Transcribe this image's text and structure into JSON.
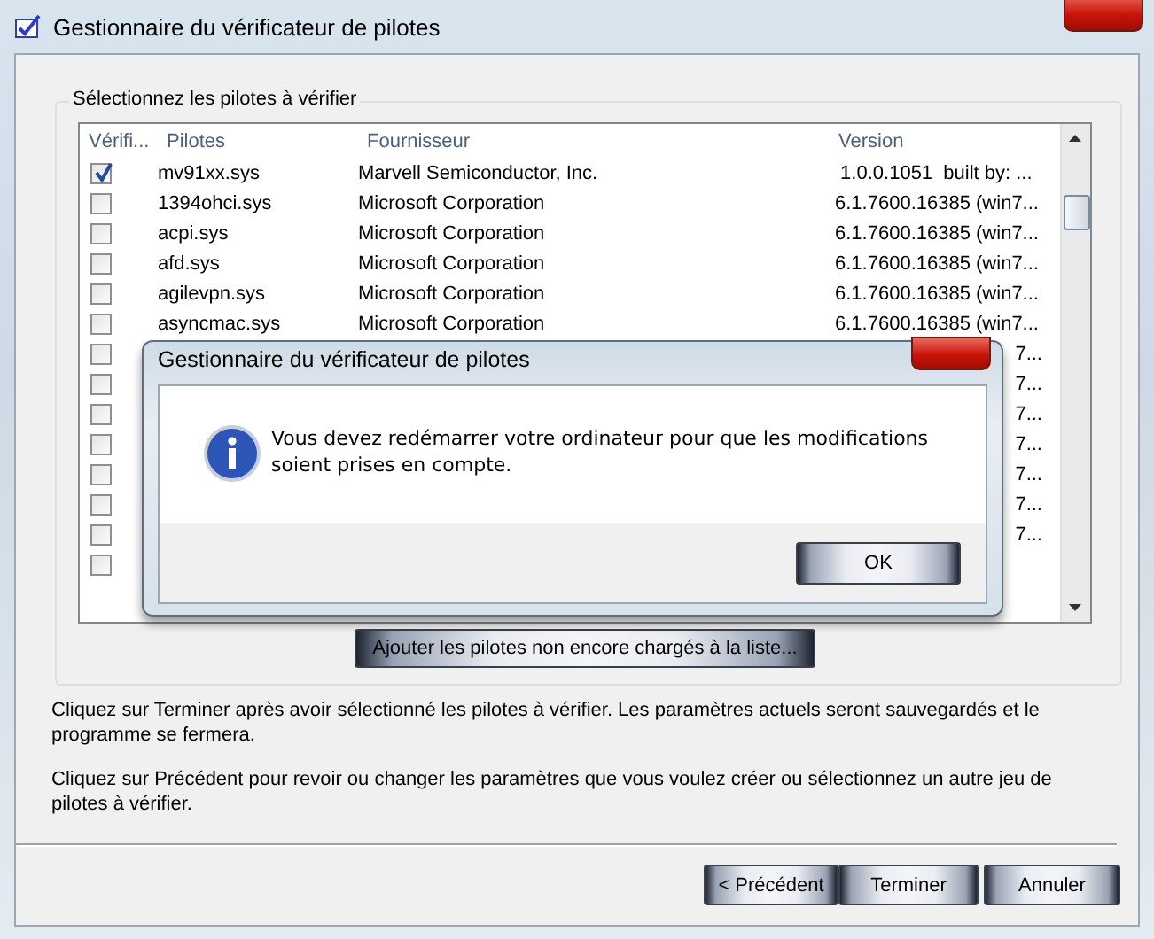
{
  "window": {
    "title": "Gestionnaire du vérificateur de pilotes"
  },
  "group": {
    "label": "Sélectionnez les pilotes à vérifier"
  },
  "table": {
    "columns": [
      "Vérifi...",
      "Pilotes",
      "Fournisseur",
      "Version"
    ],
    "rows": [
      {
        "kind": "full",
        "checked": true,
        "name": "mv91xx.sys",
        "vendor": "Marvell Semiconductor, Inc.",
        "version": " 1.0.0.1051  built by: ..."
      },
      {
        "kind": "full",
        "checked": false,
        "name": "1394ohci.sys",
        "vendor": "Microsoft Corporation",
        "version": "6.1.7600.16385 (win7..."
      },
      {
        "kind": "full",
        "checked": false,
        "name": "acpi.sys",
        "vendor": "Microsoft Corporation",
        "version": "6.1.7600.16385 (win7..."
      },
      {
        "kind": "full",
        "checked": false,
        "name": "afd.sys",
        "vendor": "Microsoft Corporation",
        "version": "6.1.7600.16385 (win7..."
      },
      {
        "kind": "full",
        "checked": false,
        "name": "agilevpn.sys",
        "vendor": "Microsoft Corporation",
        "version": "6.1.7600.16385 (win7..."
      },
      {
        "kind": "full",
        "checked": false,
        "name": "asyncmac.sys",
        "vendor": "Microsoft Corporation",
        "version": "6.1.7600.16385 (win7..."
      },
      {
        "kind": "covered",
        "checked": false,
        "version": "7..."
      },
      {
        "kind": "covered",
        "checked": false,
        "version": "7..."
      },
      {
        "kind": "covered",
        "checked": false,
        "version": "7..."
      },
      {
        "kind": "covered",
        "checked": false,
        "version": "7..."
      },
      {
        "kind": "covered",
        "checked": false,
        "version": "7..."
      },
      {
        "kind": "covered",
        "checked": false,
        "version": "7..."
      },
      {
        "kind": "covered",
        "checked": false,
        "version": "7..."
      },
      {
        "kind": "covered",
        "checked": false
      }
    ]
  },
  "add_button": "Ajouter les pilotes non encore chargés à la liste...",
  "instructions": [
    "Cliquez sur Terminer après avoir sélectionné les pilotes à vérifier. Les paramètres actuels seront sauvegardés et le programme se fermera.",
    "Cliquez sur Précédent pour revoir ou changer les paramètres que vous voulez créer ou sélectionnez un autre jeu de pilotes à vérifier."
  ],
  "buttons": [
    "< Précédent",
    "Terminer",
    "Annuler"
  ],
  "dialog": {
    "title": "Gestionnaire du vérificateur de pilotes",
    "message": "Vous devez redémarrer votre ordinateur pour que les modifications soient prises en compte.",
    "button": "OK"
  }
}
